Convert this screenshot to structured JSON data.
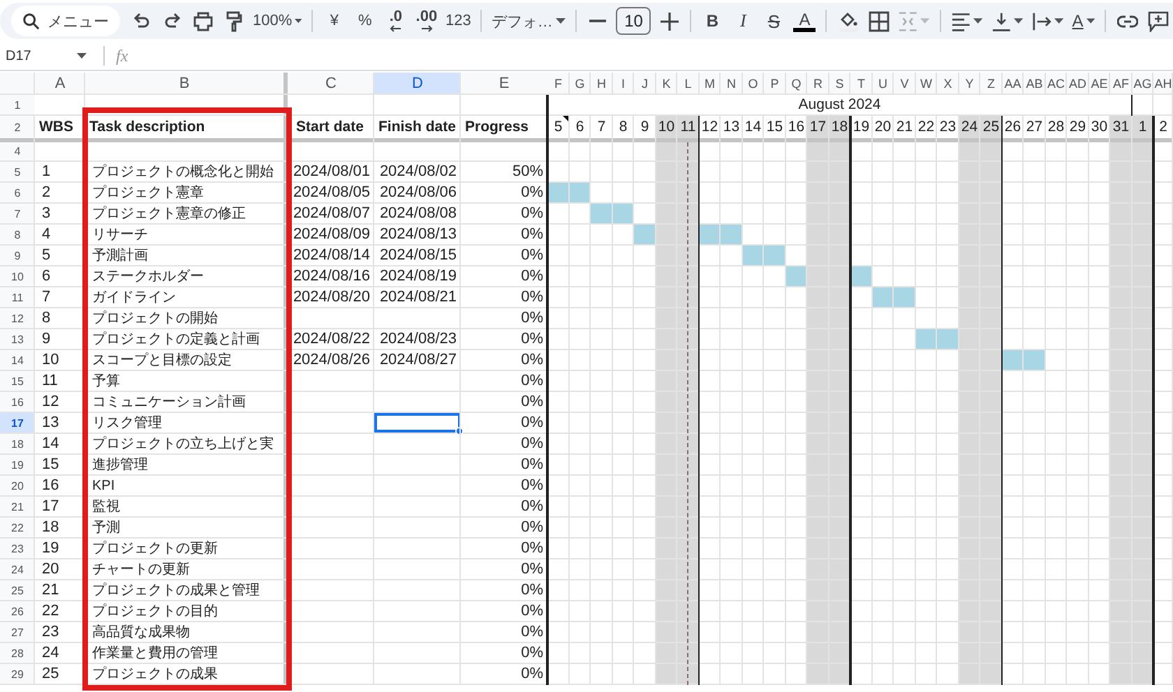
{
  "toolbar": [
    {
      "kind": "search",
      "text": "メニュー"
    },
    {
      "kind": "undo"
    },
    {
      "kind": "redo"
    },
    {
      "kind": "print"
    },
    {
      "kind": "paint"
    },
    {
      "kind": "zoom",
      "text": "100%",
      "dropdown": true
    },
    {
      "kind": "sep"
    },
    {
      "kind": "text",
      "text": "¥"
    },
    {
      "kind": "text",
      "text": "%"
    },
    {
      "kind": "dec",
      "text": ".0"
    },
    {
      "kind": "inc",
      "text": ".00"
    },
    {
      "kind": "text",
      "text": "123"
    },
    {
      "kind": "sep"
    },
    {
      "kind": "font",
      "text": "デフォ…",
      "dropdown": true
    },
    {
      "kind": "sep"
    },
    {
      "kind": "minus"
    },
    {
      "kind": "size",
      "text": "10"
    },
    {
      "kind": "plus"
    },
    {
      "kind": "sep"
    },
    {
      "kind": "bold",
      "text": "B"
    },
    {
      "kind": "italic",
      "text": "I"
    },
    {
      "kind": "strike",
      "text": "S"
    },
    {
      "kind": "color",
      "text": "A"
    },
    {
      "kind": "sep"
    },
    {
      "kind": "fill"
    },
    {
      "kind": "borders"
    },
    {
      "kind": "merge",
      "dropdown": true,
      "disabled": true
    },
    {
      "kind": "sep"
    },
    {
      "kind": "align",
      "dropdown": true
    },
    {
      "kind": "valign",
      "dropdown": true
    },
    {
      "kind": "wrap",
      "dropdown": true
    },
    {
      "kind": "rotate",
      "text": "A",
      "dropdown": true
    },
    {
      "kind": "sep"
    },
    {
      "kind": "link"
    },
    {
      "kind": "comment"
    }
  ],
  "formula_bar": {
    "cell": "D17",
    "fx": "fx"
  },
  "columns": [
    {
      "letter": "A",
      "selected": false,
      "highlighted": false
    },
    {
      "letter": "B",
      "selected": false,
      "highlighted": true
    },
    {
      "letter": "C",
      "selected": false,
      "highlighted": false
    },
    {
      "letter": "D",
      "selected": true,
      "highlighted": false
    },
    {
      "letter": "E",
      "selected": false,
      "highlighted": false
    }
  ],
  "months": [
    {
      "name": "August 2024",
      "days": [
        {
          "letter": "F",
          "day": "5",
          "weekend": false,
          "note": true
        },
        {
          "letter": "G",
          "day": "6",
          "weekend": false
        },
        {
          "letter": "H",
          "day": "7",
          "weekend": false
        },
        {
          "letter": "I",
          "day": "8",
          "weekend": false
        },
        {
          "letter": "J",
          "day": "9",
          "weekend": false
        },
        {
          "letter": "K",
          "day": "10",
          "weekend": true
        },
        {
          "letter": "L",
          "day": "11",
          "weekend": true,
          "today": true
        },
        {
          "letter": "M",
          "day": "12",
          "weekend": false
        },
        {
          "letter": "N",
          "day": "13",
          "weekend": false
        },
        {
          "letter": "O",
          "day": "14",
          "weekend": false
        },
        {
          "letter": "P",
          "day": "15",
          "weekend": false
        },
        {
          "letter": "Q",
          "day": "16",
          "weekend": false
        },
        {
          "letter": "R",
          "day": "17",
          "weekend": true
        },
        {
          "letter": "S",
          "day": "18",
          "weekend": true
        },
        {
          "letter": "T",
          "day": "19",
          "weekend": false
        },
        {
          "letter": "U",
          "day": "20",
          "weekend": false
        },
        {
          "letter": "V",
          "day": "21",
          "weekend": false
        },
        {
          "letter": "W",
          "day": "22",
          "weekend": false
        },
        {
          "letter": "X",
          "day": "23",
          "weekend": false
        },
        {
          "letter": "Y",
          "day": "24",
          "weekend": true
        },
        {
          "letter": "Z",
          "day": "25",
          "weekend": true
        },
        {
          "letter": "AA",
          "day": "26",
          "weekend": false
        },
        {
          "letter": "AB",
          "day": "27",
          "weekend": false
        },
        {
          "letter": "AC",
          "day": "28",
          "weekend": false
        },
        {
          "letter": "AD",
          "day": "29",
          "weekend": false
        },
        {
          "letter": "AE",
          "day": "30",
          "weekend": false
        },
        {
          "letter": "AF",
          "day": "31",
          "weekend": true
        }
      ]
    },
    {
      "days": [
        {
          "letter": "AG",
          "day": "1",
          "weekend": true
        },
        {
          "letter": "AH",
          "day": "2",
          "weekend": false
        }
      ]
    }
  ],
  "header_rows": {
    "month_row": "1",
    "label_row": "2",
    "blank_row": "4",
    "labels": [
      "WBS",
      "Task description",
      "Start date",
      "Finish date",
      "Progress"
    ]
  },
  "rows": [
    {
      "num": "5",
      "wbs": "1",
      "task": "プロジェクトの概念化と開始",
      "start": "2024/08/01",
      "finish": "2024/08/02",
      "progress": "50%",
      "selected": false
    },
    {
      "num": "6",
      "wbs": "2",
      "task": "プロジェクト憲章",
      "start": "2024/08/05",
      "finish": "2024/08/06",
      "progress": "0%",
      "selected": false
    },
    {
      "num": "7",
      "wbs": "3",
      "task": "プロジェクト憲章の修正",
      "start": "2024/08/07",
      "finish": "2024/08/08",
      "progress": "0%",
      "selected": false
    },
    {
      "num": "8",
      "wbs": "4",
      "task": "リサーチ",
      "start": "2024/08/09",
      "finish": "2024/08/13",
      "progress": "0%",
      "selected": false
    },
    {
      "num": "9",
      "wbs": "5",
      "task": "予測計画",
      "start": "2024/08/14",
      "finish": "2024/08/15",
      "progress": "0%",
      "selected": false
    },
    {
      "num": "10",
      "wbs": "6",
      "task": "ステークホルダー",
      "start": "2024/08/16",
      "finish": "2024/08/19",
      "progress": "0%",
      "selected": false
    },
    {
      "num": "11",
      "wbs": "7",
      "task": "ガイドライン",
      "start": "2024/08/20",
      "finish": "2024/08/21",
      "progress": "0%",
      "selected": false
    },
    {
      "num": "12",
      "wbs": "8",
      "task": "プロジェクトの開始",
      "progress": "0%",
      "selected": false
    },
    {
      "num": "13",
      "wbs": "9",
      "task": "プロジェクトの定義と計画",
      "start": "2024/08/22",
      "finish": "2024/08/23",
      "progress": "0%",
      "selected": false
    },
    {
      "num": "14",
      "wbs": "10",
      "task": "スコープと目標の設定",
      "start": "2024/08/26",
      "finish": "2024/08/27",
      "progress": "0%",
      "selected": false
    },
    {
      "num": "15",
      "wbs": "11",
      "task": "予算",
      "progress": "0%",
      "selected": false
    },
    {
      "num": "16",
      "wbs": "12",
      "task": "コミュニケーション計画",
      "progress": "0%",
      "selected": false
    },
    {
      "num": "17",
      "wbs": "13",
      "task": "リスク管理",
      "progress": "0%",
      "selected": true
    },
    {
      "num": "18",
      "wbs": "14",
      "task": "プロジェクトの立ち上げと実",
      "progress": "0%",
      "selected": false
    },
    {
      "num": "19",
      "wbs": "15",
      "task": "進捗管理",
      "progress": "0%",
      "selected": false
    },
    {
      "num": "20",
      "wbs": "16",
      "task": "KPI",
      "progress": "0%",
      "selected": false
    },
    {
      "num": "21",
      "wbs": "17",
      "task": "監視",
      "progress": "0%",
      "selected": false
    },
    {
      "num": "22",
      "wbs": "18",
      "task": "予測",
      "progress": "0%",
      "selected": false
    },
    {
      "num": "23",
      "wbs": "19",
      "task": "プロジェクトの更新",
      "progress": "0%",
      "selected": false
    },
    {
      "num": "24",
      "wbs": "20",
      "task": "チャートの更新",
      "progress": "0%",
      "selected": false
    },
    {
      "num": "25",
      "wbs": "21",
      "task": "プロジェクトの成果と管理",
      "progress": "0%",
      "selected": false
    },
    {
      "num": "26",
      "wbs": "22",
      "task": "プロジェクトの目的",
      "progress": "0%",
      "selected": false
    },
    {
      "num": "27",
      "wbs": "23",
      "task": "高品質な成果物",
      "progress": "0%",
      "selected": false
    },
    {
      "num": "28",
      "wbs": "24",
      "task": "作業量と費用の管理",
      "progress": "0%",
      "selected": false
    },
    {
      "num": "29",
      "wbs": "25",
      "task": "プロジェクトの成果",
      "progress": "0%",
      "selected": false
    }
  ]
}
